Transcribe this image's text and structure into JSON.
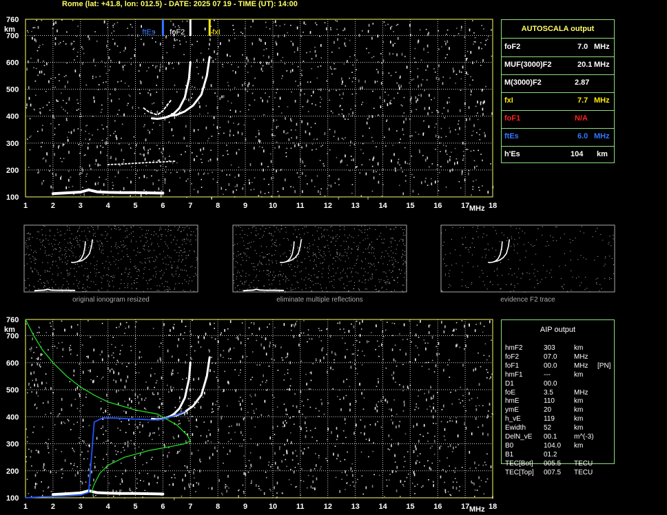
{
  "header": "Rome (lat: +41.8, lon: 012.5) - DATE: 2025 07 19 - TIME (UT): 14:00",
  "colors": {
    "frame": "#ffff66",
    "grid": "#d8d8d8",
    "panel_border": "#8fe07a",
    "ftEs": "#3377ff",
    "fxI": "#ffee00",
    "foF1": "#ff2222",
    "profile": "#22dd22",
    "trace_blue": "#2255ff"
  },
  "chart_data": [
    {
      "type": "scatter",
      "name_in_ui": "ionogram-top",
      "x_range": [
        1,
        18
      ],
      "y_range": [
        100,
        760
      ],
      "x_ticks": [
        1,
        2,
        3,
        4,
        5,
        6,
        7,
        8,
        9,
        10,
        11,
        12,
        13,
        14,
        15,
        16,
        17,
        18
      ],
      "y_ticks": [
        100,
        200,
        300,
        400,
        500,
        600,
        700,
        760
      ],
      "xlabel": "MHz",
      "ylabel": "km",
      "grid": true,
      "markers": [
        {
          "label": "ftEs",
          "x": 6.0,
          "color": "#3377ff"
        },
        {
          "label": "foF2",
          "x": 7.0,
          "color": "#ffffff"
        },
        {
          "label": "fxI",
          "x": 7.7,
          "color": "#ffee00"
        }
      ],
      "traces": {
        "es_layer": {
          "x": [
            2.0,
            2.5,
            3.0,
            3.3,
            3.6,
            4.0,
            4.5,
            5.0,
            5.5,
            6.0
          ],
          "y": [
            112,
            115,
            118,
            126,
            119,
            117,
            116,
            116,
            115,
            114
          ]
        },
        "o_trace": {
          "x": [
            5.6,
            5.8,
            6.0,
            6.2,
            6.4,
            6.6,
            6.8,
            6.95,
            7.0
          ],
          "y": [
            392,
            390,
            393,
            398,
            410,
            430,
            470,
            540,
            600
          ]
        },
        "x_trace": {
          "x": [
            6.2,
            6.5,
            6.8,
            7.1,
            7.4,
            7.6,
            7.7
          ],
          "y": [
            400,
            405,
            418,
            440,
            480,
            550,
            620
          ]
        },
        "weak_trace": {
          "x": [
            5.3,
            5.5,
            5.8,
            6.0,
            6.3
          ],
          "y": [
            430,
            415,
            405,
            420,
            460
          ]
        },
        "multiple_es": {
          "x": [
            4.0,
            4.5,
            5.0,
            5.5,
            6.0,
            6.5
          ],
          "y": [
            220,
            222,
            225,
            228,
            230,
            233
          ]
        }
      }
    },
    {
      "type": "scatter",
      "name_in_ui": "ionogram-bottom",
      "x_range": [
        1,
        18
      ],
      "y_range": [
        100,
        760
      ],
      "x_ticks": [
        1,
        2,
        3,
        4,
        5,
        6,
        7,
        8,
        9,
        10,
        11,
        12,
        13,
        14,
        15,
        16,
        17,
        18
      ],
      "y_ticks": [
        100,
        200,
        300,
        400,
        500,
        600,
        700,
        760
      ],
      "xlabel": "MHz",
      "ylabel": "km",
      "grid": true,
      "profile": {
        "x": [
          1.0,
          1.3,
          1.6,
          2.0,
          2.5,
          3.0,
          3.5,
          4.0,
          5.0,
          5.8,
          6.5,
          6.9,
          7.0,
          6.8,
          6.3,
          5.5,
          4.6,
          4.0,
          3.7,
          3.5,
          3.4
        ],
        "y": [
          760,
          700,
          650,
          600,
          550,
          510,
          480,
          455,
          425,
          410,
          370,
          330,
          310,
          300,
          290,
          275,
          250,
          220,
          190,
          150,
          120
        ]
      },
      "blue_trace": {
        "x": [
          1.0,
          1.5,
          2.0,
          2.5,
          3.0,
          3.3,
          3.5,
          3.8,
          4.2,
          4.8,
          5.3,
          5.7,
          6.0,
          6.3,
          6.6,
          6.8
        ],
        "y": [
          100,
          103,
          105,
          107,
          110,
          120,
          380,
          395,
          395,
          392,
          390,
          388,
          392,
          400,
          410,
          420
        ]
      }
    }
  ],
  "small_panels": [
    {
      "caption": "original ionogram resized"
    },
    {
      "caption": "eliminate multiple reflections"
    },
    {
      "caption": "evidence F2 trace"
    }
  ],
  "autoscala": {
    "title": "AUTOSCALA output",
    "rows": [
      {
        "name": "foF2",
        "value": "7.0",
        "unit": "MHz",
        "color": "#ffffff"
      },
      {
        "name": "MUF(3000)F2",
        "value": "20.1",
        "unit": "MHz",
        "color": "#ffffff"
      },
      {
        "name": "M(3000)F2",
        "value": "2.87",
        "unit": "",
        "color": "#ffffff"
      },
      {
        "name": "fxI",
        "value": "7.7",
        "unit": "MHz",
        "color": "#ffee00"
      },
      {
        "name": "foF1",
        "value": "N/A",
        "unit": "",
        "color": "#ff2222"
      },
      {
        "name": "ftEs",
        "value": "6.0",
        "unit": "MHz",
        "color": "#3377ff"
      },
      {
        "name": "h'Es",
        "value": "104",
        "unit": "km",
        "color": "#ffffff"
      }
    ]
  },
  "aip": {
    "title": "AIP output",
    "rows": [
      {
        "name": "hmF2",
        "value": "303",
        "unit": "km",
        "extra": ""
      },
      {
        "name": "foF2",
        "value": "07.0",
        "unit": "MHz",
        "extra": ""
      },
      {
        "name": "foF1",
        "value": "00.0",
        "unit": "MHz",
        "extra": "[PN]"
      },
      {
        "name": "hmF1",
        "value": "---",
        "unit": "km",
        "extra": ""
      },
      {
        "name": "D1",
        "value": "00.0",
        "unit": "",
        "extra": ""
      },
      {
        "name": "foE",
        "value": "3.5",
        "unit": "MHz",
        "extra": ""
      },
      {
        "name": "hmE",
        "value": "110",
        "unit": "km",
        "extra": ""
      },
      {
        "name": "ymE",
        "value": "20",
        "unit": "km",
        "extra": ""
      },
      {
        "name": "h_vE",
        "value": "119",
        "unit": "km",
        "extra": ""
      },
      {
        "name": "Ewidth",
        "value": "52",
        "unit": "km",
        "extra": ""
      },
      {
        "name": "DelN_vE",
        "value": "00.1",
        "unit": "m^(-3)",
        "extra": ""
      },
      {
        "name": "B0",
        "value": "104.0",
        "unit": "km",
        "extra": ""
      },
      {
        "name": "B1",
        "value": "01.2",
        "unit": "",
        "extra": ""
      },
      {
        "name": "TEC[Bot]",
        "value": "005.5",
        "unit": "TECU",
        "extra": ""
      },
      {
        "name": "TEC[Top]",
        "value": "007.5",
        "unit": "TECU",
        "extra": ""
      }
    ]
  }
}
